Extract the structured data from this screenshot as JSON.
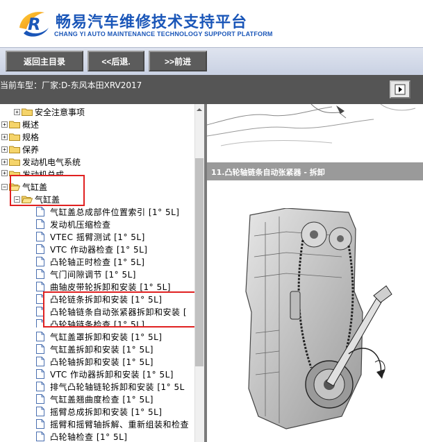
{
  "header": {
    "title": "畅易汽车维修技术支持平台",
    "subtitle": "CHANG YI AUTO MAINTENANCE TECHNOLOGY SUPPORT PLATFORM",
    "logo_letter": "R",
    "brand_color": "#1a56b8"
  },
  "nav": {
    "home_label": "返回主目录",
    "back_label": "<<后退.",
    "forward_label": ">>前进"
  },
  "vehicle": {
    "label": "当前车型：厂家:D-东风本田XRV2017"
  },
  "tree": {
    "top_nodes": [
      {
        "label": "安全注意事项",
        "expanded": false
      },
      {
        "label": "概述",
        "expanded": false
      },
      {
        "label": "规格",
        "expanded": false
      },
      {
        "label": "保养",
        "expanded": false
      },
      {
        "label": "发动机电气系统",
        "expanded": false
      },
      {
        "label": "发动机总成",
        "expanded": false
      },
      {
        "label": "气缸盖",
        "expanded": true
      }
    ],
    "sub_node": {
      "label": "气缸盖",
      "expanded": true
    },
    "leaves": [
      "气缸盖总成部件位置索引 [1° 5L]",
      "发动机压缩检查",
      "VTEC 摇臂测试 [1° 5L]",
      "VTC 作动器检查 [1° 5L]",
      "凸轮轴正时检查 [1° 5L]",
      "气门间隙调节 [1° 5L]",
      "曲轴皮带轮拆卸和安装 [1° 5L]",
      "凸轮链条拆卸和安装 [1° 5L]",
      "凸轮轴链条自动张紧器拆卸和安装 [",
      "凸轮轴链条检查 [1° 5L]",
      "气缸盖罩拆卸和安装 [1° 5L]",
      "气缸盖拆卸和安装 [1° 5L]",
      "凸轮轴拆卸和安装 [1° 5L]",
      "VTC 作动器拆卸和安装 [1° 5L]",
      "排气凸轮轴链轮拆卸和安装 [1° 5L",
      "气缸盖翘曲度检查 [1° 5L]",
      "摇臂总成拆卸和安装 [1° 5L]",
      "摇臂和摇臂轴拆解、重新组装和检查",
      "凸轮轴检查 [1° 5L]"
    ]
  },
  "content": {
    "section_title": "11.凸轮轴链条自动张紧器 - 拆卸"
  },
  "colors": {
    "highlight_box": "#e02020",
    "nav_button": "#5c5c5c",
    "vehicle_bar": "#555555",
    "section_bar": "#9a9a9a"
  }
}
